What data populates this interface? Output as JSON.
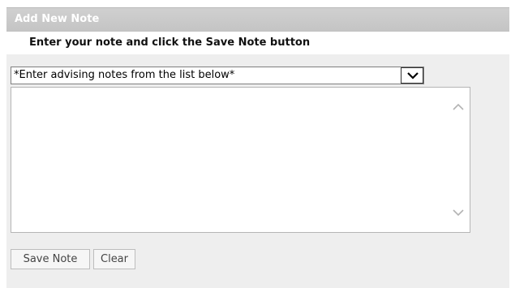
{
  "panel": {
    "title": "Add New Note",
    "instruction": "Enter your note and click the Save Note button"
  },
  "notes_select": {
    "selected": "*Enter advising notes from the list below*",
    "arrow_icon": "chevron-down-icon"
  },
  "note_textarea": {
    "value": "",
    "scroll_up_icon": "chevron-up-icon",
    "scroll_down_icon": "chevron-down-icon"
  },
  "buttons": {
    "save_label": "Save Note",
    "clear_label": "Clear"
  },
  "colors": {
    "header_bg": "#c8c8c8",
    "panel_bg": "#eeeeee",
    "header_text": "#ffffff"
  }
}
